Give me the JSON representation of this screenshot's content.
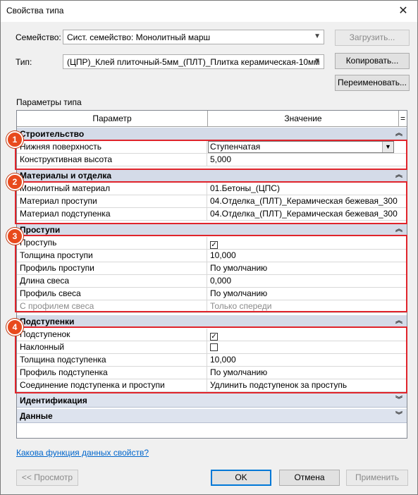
{
  "window": {
    "title": "Свойства типа",
    "close_glyph": "✕"
  },
  "family": {
    "label": "Семейство:",
    "value": "Сист. семейство: Монолитный марш",
    "load_button": "Загрузить..."
  },
  "type": {
    "label": "Тип:",
    "value": "(ЦПР)_Клей плиточный-5мм_(ПЛТ)_Плитка керамическая-10мм",
    "duplicate_button": "Копировать...",
    "rename_button": "Переименовать..."
  },
  "type_parameters_label": "Параметры типа",
  "grid": {
    "col_param": "Параметр",
    "col_value": "Значение",
    "col_extra": "=",
    "sections": {
      "construction": {
        "title": "Строительство",
        "rows": [
          {
            "name": "Нижняя поверхность",
            "value": "Ступенчатая"
          },
          {
            "name": "Конструктивная высота",
            "value": "5,000"
          }
        ]
      },
      "materials": {
        "title": "Материалы и отделка",
        "rows": [
          {
            "name": "Монолитный материал",
            "value": "01.Бетоны_(ЦПС)"
          },
          {
            "name": "Материал проступи",
            "value": "04.Отделка_(ПЛТ)_Керамическая бежевая_300"
          },
          {
            "name": "Материал подступенка",
            "value": "04.Отделка_(ПЛТ)_Керамическая бежевая_300"
          }
        ]
      },
      "treads": {
        "title": "Проступи",
        "rows": [
          {
            "name": "Проступь",
            "value": ""
          },
          {
            "name": "Толщина проступи",
            "value": "10,000"
          },
          {
            "name": "Профиль проступи",
            "value": "По умолчанию"
          },
          {
            "name": "Длина свеса",
            "value": "0,000"
          },
          {
            "name": "Профиль свеса",
            "value": "По умолчанию"
          },
          {
            "name": "С профилем свеса",
            "value": "Только спереди"
          }
        ]
      },
      "risers": {
        "title": "Подступенки",
        "rows": [
          {
            "name": "Подступенок",
            "value": ""
          },
          {
            "name": "Наклонный",
            "value": ""
          },
          {
            "name": "Толщина подступенка",
            "value": "10,000"
          },
          {
            "name": "Профиль подступенка",
            "value": "По умолчанию"
          },
          {
            "name": "Соединение подступенка и проступи",
            "value": "Удлинить подступенок за проступь"
          }
        ]
      },
      "identity": {
        "title": "Идентификация"
      },
      "data": {
        "title": "Данные"
      }
    },
    "checkbox_states": {
      "tread": true,
      "riser": true,
      "slanted": false
    },
    "check_glyph": "✓",
    "collapse_glyph": "︽",
    "expand_glyph": "︾"
  },
  "badges": [
    "1",
    "2",
    "3",
    "4"
  ],
  "help_link": "Какова функция данных свойств?",
  "footer": {
    "preview": "<< Просмотр",
    "ok": "OK",
    "cancel": "Отмена",
    "apply": "Применить"
  },
  "colors": {
    "highlight": "#e0242b",
    "badge": "#e84a1d",
    "section_bg": "#d4dbe8",
    "link": "#0066cc"
  }
}
